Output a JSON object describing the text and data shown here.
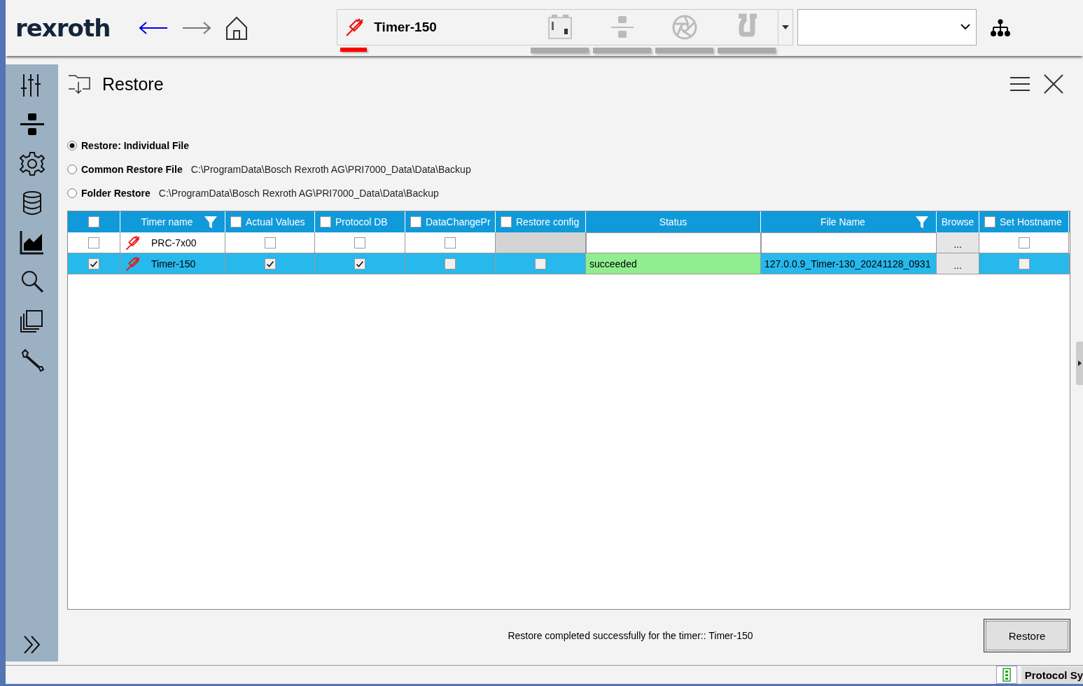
{
  "header": {
    "logo": "rexroth",
    "device": {
      "name": "Timer-150",
      "connected": false
    }
  },
  "panel": {
    "title": "Restore",
    "options": [
      {
        "label": "Restore: Individual File",
        "selected": true
      },
      {
        "label": "Common Restore File",
        "path": "C:\\ProgramData\\Bosch Rexroth AG\\PRI7000_Data\\Data\\Backup",
        "selected": false
      },
      {
        "label": "Folder Restore",
        "path": "C:\\ProgramData\\Bosch Rexroth AG\\PRI7000_Data\\Data\\Backup",
        "selected": false
      }
    ],
    "table": {
      "columns": [
        {
          "kind": "check",
          "checked": false
        },
        {
          "kind": "filter",
          "label": "Timer name"
        },
        {
          "kind": "check",
          "label": "Actual Values",
          "checked": false
        },
        {
          "kind": "check",
          "label": "Protocol DB",
          "checked": false
        },
        {
          "kind": "check",
          "label": "DataChangePr",
          "checked": false
        },
        {
          "kind": "check",
          "label": "Restore config",
          "checked": false
        },
        {
          "kind": "text",
          "label": "Status"
        },
        {
          "kind": "filter",
          "label": "File Name"
        },
        {
          "kind": "text",
          "label": "Browse"
        },
        {
          "kind": "check",
          "label": "Set Hostname",
          "checked": false
        }
      ],
      "rows": [
        {
          "selected": false,
          "cells": [
            {
              "kind": "check",
              "checked": false
            },
            {
              "kind": "timer",
              "text": "PRC-7x00",
              "connected": false
            },
            {
              "kind": "check",
              "checked": false
            },
            {
              "kind": "check",
              "checked": false
            },
            {
              "kind": "check",
              "checked": false
            },
            {
              "kind": "disabled"
            },
            {
              "kind": "text"
            },
            {
              "kind": "text"
            },
            {
              "kind": "button",
              "text": "..."
            },
            {
              "kind": "check",
              "checked": false
            }
          ]
        },
        {
          "selected": true,
          "cells": [
            {
              "kind": "check",
              "checked": true
            },
            {
              "kind": "timer",
              "text": "Timer-150",
              "connected": false
            },
            {
              "kind": "check",
              "checked": true
            },
            {
              "kind": "check",
              "checked": true
            },
            {
              "kind": "check",
              "checked": false
            },
            {
              "kind": "check",
              "checked": false
            },
            {
              "kind": "text",
              "text": "succeeded",
              "color": "#90ee90"
            },
            {
              "kind": "text",
              "text": "127.0.0.9_Timer-130_20241128_0931"
            },
            {
              "kind": "button",
              "text": "..."
            },
            {
              "kind": "check",
              "checked": false
            }
          ]
        }
      ]
    },
    "message": "Restore completed successfully for the timer:: Timer-150",
    "button": "Restore"
  },
  "status_bar": {
    "label": "Protocol Sy"
  }
}
